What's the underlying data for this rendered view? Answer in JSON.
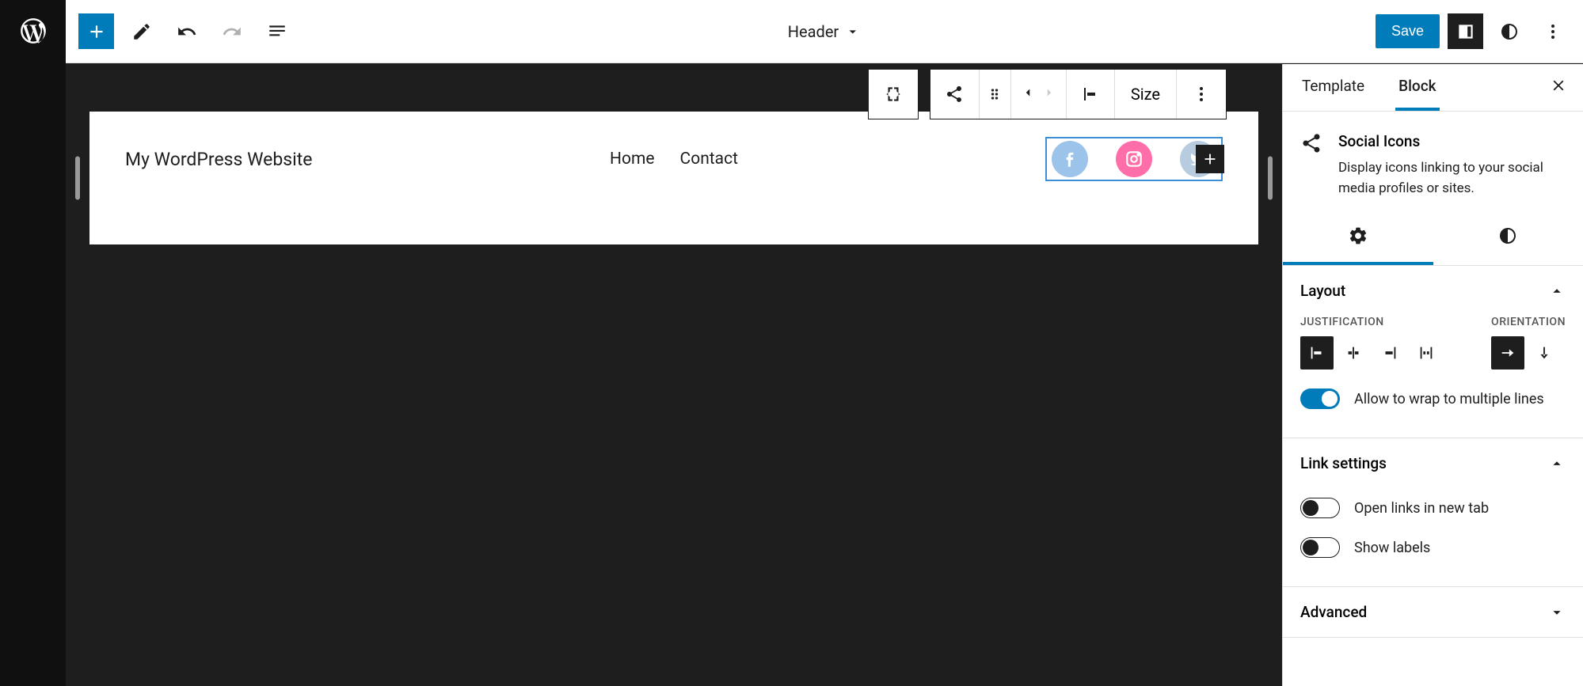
{
  "toolbar": {
    "document_title": "Header",
    "save_label": "Save"
  },
  "header_block": {
    "site_title": "My WordPress Website",
    "nav": [
      "Home",
      "Contact"
    ]
  },
  "floating_toolbar": {
    "size_label": "Size"
  },
  "sidebar": {
    "tabs": {
      "template": "Template",
      "block": "Block"
    },
    "block_info": {
      "title": "Social Icons",
      "description": "Display icons linking to your social media profiles or sites."
    },
    "panels": {
      "layout": {
        "title": "Layout",
        "justification_label": "JUSTIFICATION",
        "orientation_label": "ORIENTATION",
        "wrap_label": "Allow to wrap to multiple lines"
      },
      "link_settings": {
        "title": "Link settings",
        "new_tab_label": "Open links in new tab",
        "show_labels_label": "Show labels"
      },
      "advanced": {
        "title": "Advanced"
      }
    }
  }
}
